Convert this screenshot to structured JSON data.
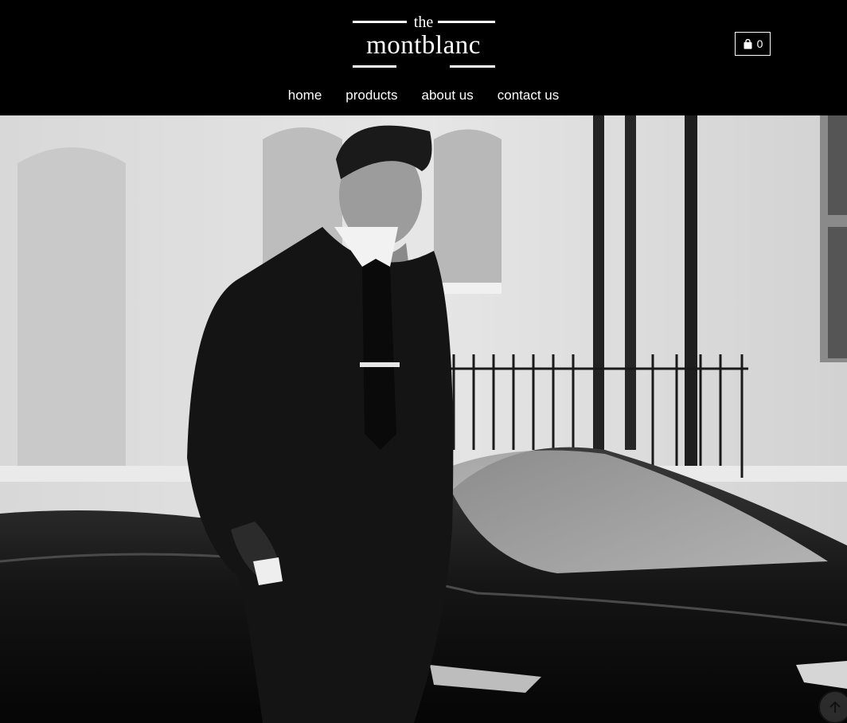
{
  "logo": {
    "small": "the",
    "name": "montblanc"
  },
  "cart": {
    "icon": "shopping-bag-icon",
    "count": "0"
  },
  "nav": [
    {
      "label": "home"
    },
    {
      "label": "products"
    },
    {
      "label": "about us"
    },
    {
      "label": "contact us"
    }
  ],
  "hero": {
    "image": "black-and-white photo of a man in a leather jacket standing in front of a black sports car"
  },
  "back_to_top": {
    "icon": "arrow-up-icon"
  },
  "colors": {
    "header_bg": "#000000",
    "text": "#ffffff"
  }
}
